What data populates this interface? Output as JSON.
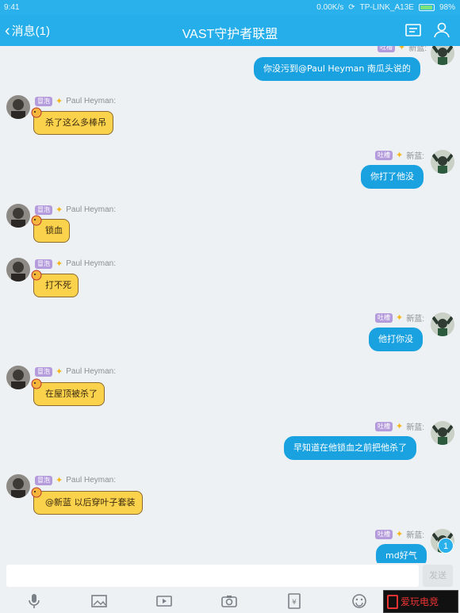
{
  "status": {
    "time": "9:41",
    "speed": "0.00K/s",
    "wifi": "TP-LINK_A13E",
    "battery": "98%"
  },
  "nav": {
    "back_label": "消息(1)",
    "title": "VAST守护者联盟"
  },
  "sender_left": {
    "badge": "冒泡",
    "name": "Paul Heyman:"
  },
  "sender_right": {
    "badge": "吐槽",
    "name": "新蓝:"
  },
  "messages": [
    {
      "side": "right",
      "text": "你没污到@Paul Heyman 南瓜头说的"
    },
    {
      "side": "left",
      "text": "杀了这么多棒吊"
    },
    {
      "side": "right",
      "text": "你打了他没"
    },
    {
      "side": "left",
      "text": "锁血"
    },
    {
      "side": "left",
      "text": "打不死"
    },
    {
      "side": "right",
      "text": "他打你没"
    },
    {
      "side": "left",
      "text": "在屋顶被杀了"
    },
    {
      "side": "right",
      "text": "早知道在他锁血之前把他杀了"
    },
    {
      "side": "left",
      "text": "@新蓝 以后穿叶子套装"
    },
    {
      "side": "right",
      "text": "md好气"
    }
  ],
  "input": {
    "send_label": "发送",
    "unread_count": "1"
  },
  "watermark": "爱玩电竞",
  "icons": [
    "mic-icon",
    "image-icon",
    "video-icon",
    "camera-icon",
    "red-packet-icon",
    "emoji-icon",
    "plus-icon",
    "profile-card-icon",
    "group-members-icon"
  ],
  "colors": {
    "header": "#25aee9",
    "blue_bubble": "#1aa1e0",
    "yellow_bubble": "#fbd24c"
  }
}
